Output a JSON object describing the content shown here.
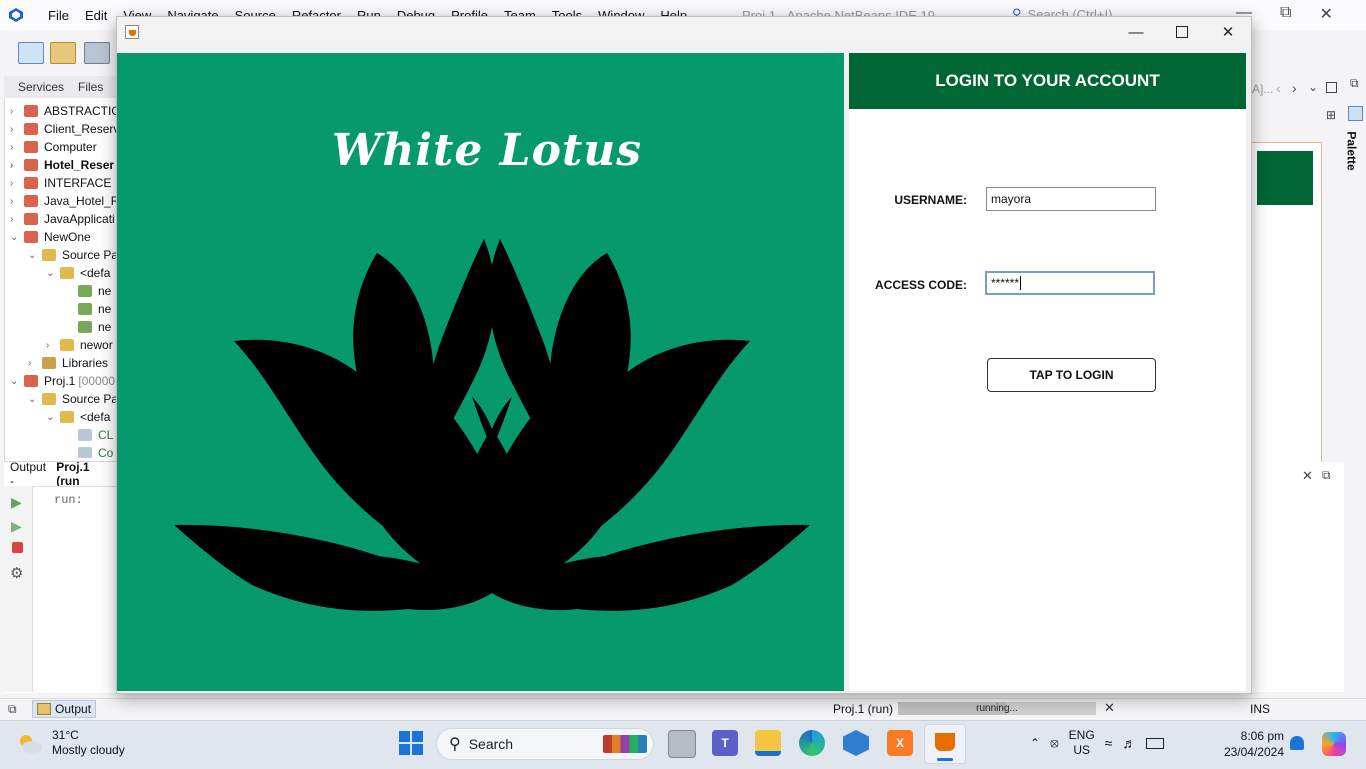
{
  "ide": {
    "menu": [
      "File",
      "Edit",
      "View",
      "Navigate",
      "Source",
      "Refactor",
      "Run",
      "Debug",
      "Profile",
      "Team",
      "Tools",
      "Window",
      "Help"
    ],
    "title": "Proj.1 - Apache NetBeans IDE 19",
    "search_placeholder": "Search (Ctrl+I)",
    "left_tabs": [
      "Services",
      "Files"
    ],
    "tree": [
      {
        "label": "ABSTRACTIO",
        "bold": false
      },
      {
        "label": "Client_Reserv",
        "bold": false
      },
      {
        "label": "Computer",
        "bold": false
      },
      {
        "label": "Hotel_Reser",
        "bold": true
      },
      {
        "label": "INTERFACE",
        "bold": false
      },
      {
        "label": "Java_Hotel_R",
        "bold": false
      },
      {
        "label": "JavaApplicati",
        "bold": false
      },
      {
        "label": "NewOne",
        "bold": false
      },
      {
        "label": "Source Pa",
        "bold": false
      },
      {
        "label": "<defa",
        "bold": false
      },
      {
        "label": "ne",
        "bold": false
      },
      {
        "label": "ne",
        "bold": false
      },
      {
        "label": "ne",
        "bold": false
      },
      {
        "label": "newor",
        "bold": false
      },
      {
        "label": "Libraries",
        "bold": false
      },
      {
        "label": "Proj.1",
        "bold": false
      },
      {
        "label": "Source Pa",
        "bold": false
      },
      {
        "label": "<defa",
        "bold": false
      },
      {
        "label": "CL",
        "bold": false
      },
      {
        "label": "Co",
        "bold": false
      }
    ],
    "proj_suffix": "[00000",
    "output_title_prefix": "Output - ",
    "output_title_project": "Proj.1 (run",
    "output_text": "run:",
    "palette_label": "Palette",
    "right_tab_fragment": "A]...",
    "status": {
      "output_tab": "Output",
      "project": "Proj.1 (run)",
      "progress_text": "running...",
      "progress_fraction": 0.55,
      "ins": "INS"
    }
  },
  "window": {
    "brand": "White Lotus",
    "header": "LOGIN TO YOUR ACCOUNT",
    "username_label": "USERNAME:",
    "username_value": "mayora",
    "access_label": "ACCESS CODE:",
    "access_value": "******",
    "login_button": "TAP TO LOGIN",
    "colors": {
      "left_bg": "#05996b",
      "header_bg": "#006633",
      "right_bg": "#ffffff"
    }
  },
  "taskbar": {
    "weather_temp": "31°C",
    "weather_desc": "Mostly cloudy",
    "search_label": "Search",
    "lang_1": "ENG",
    "lang_2": "US",
    "time": "8:06 pm",
    "date": "23/04/2024"
  }
}
